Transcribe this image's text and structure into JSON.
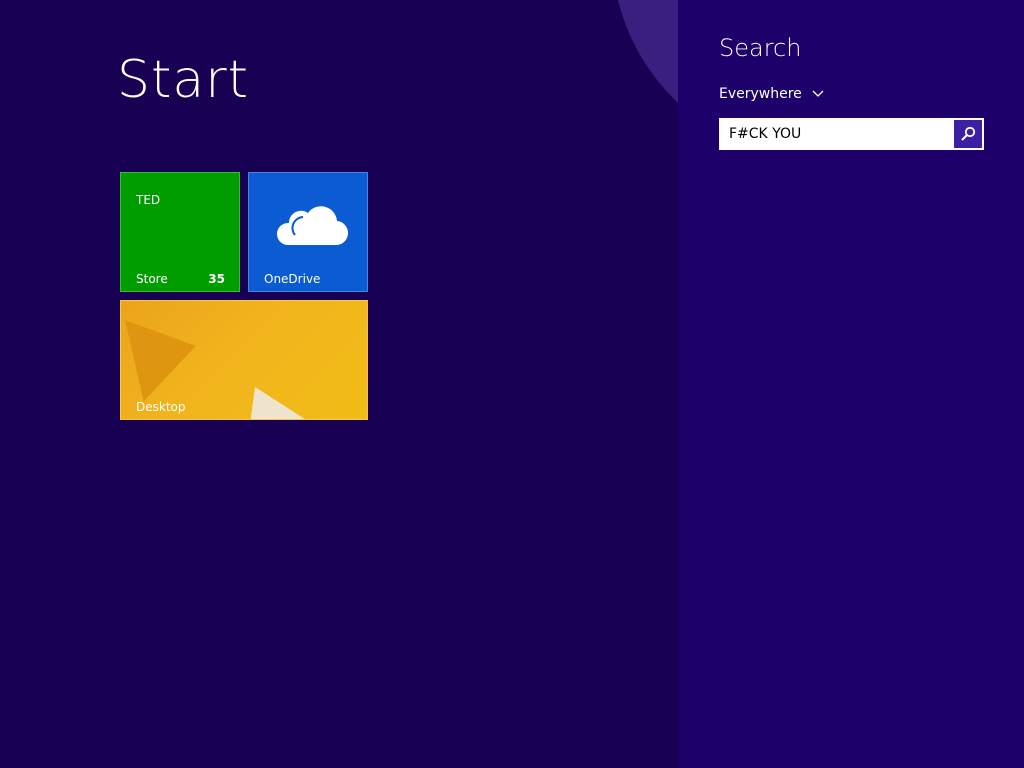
{
  "start": {
    "title": "Start"
  },
  "tiles": {
    "store": {
      "top_text": "TED",
      "label": "Store",
      "badge": "35",
      "color": "#009d00"
    },
    "onedrive": {
      "label": "OneDrive",
      "icon": "cloud-icon",
      "color": "#0b5bd2"
    },
    "desktop": {
      "label": "Desktop",
      "color": "#f1b41d"
    }
  },
  "search": {
    "title": "Search",
    "scope": "Everywhere",
    "query": "F#CK YOU",
    "button_icon": "magnifier-icon",
    "pane_color": "#1d006a"
  },
  "colors": {
    "background": "#180052",
    "accent": "#3d1fa3"
  }
}
